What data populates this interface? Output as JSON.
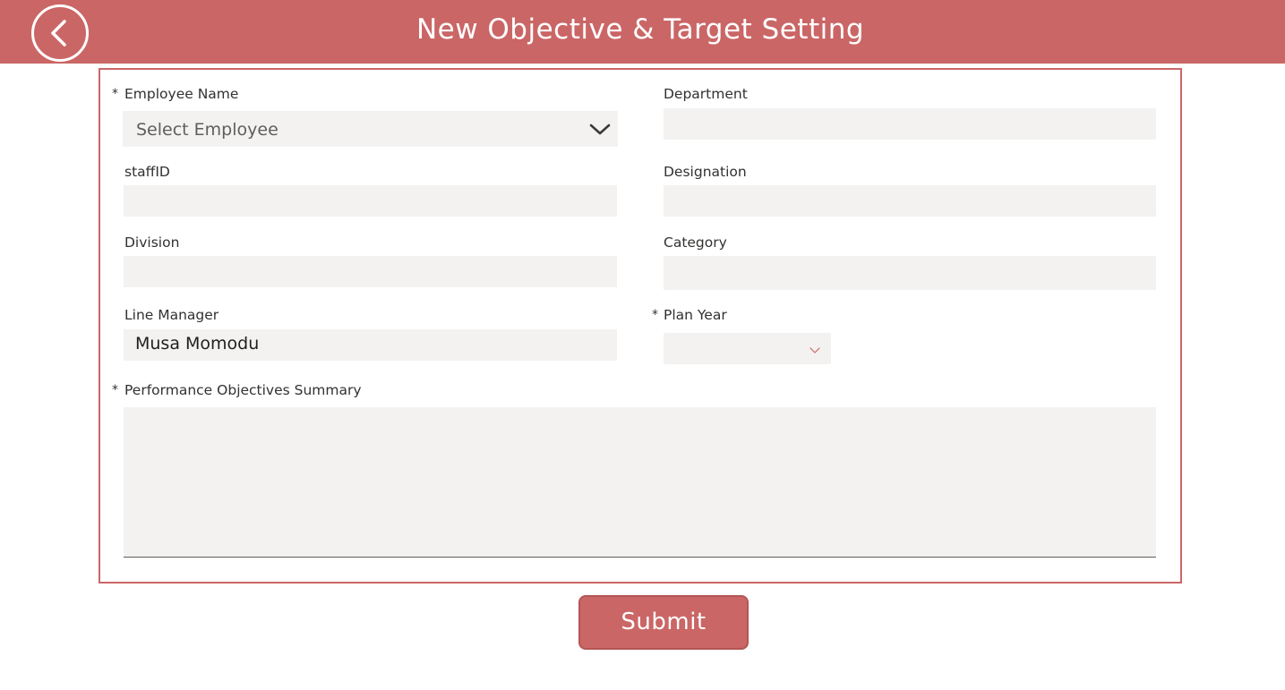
{
  "header": {
    "title": "New Objective & Target Setting",
    "back_icon": "chevron-left-circle-icon",
    "background_color": "#cb6666"
  },
  "form": {
    "required_marker": "*",
    "employee_name": {
      "label": "Employee Name",
      "required": true,
      "placeholder": "Select Employee",
      "icon": "chevron-down-icon"
    },
    "department": {
      "label": "Department",
      "value": ""
    },
    "staff_id": {
      "label": "staffID",
      "value": ""
    },
    "designation": {
      "label": "Designation",
      "value": ""
    },
    "division": {
      "label": "Division",
      "value": ""
    },
    "category": {
      "label": "Category",
      "value": ""
    },
    "line_manager": {
      "label": "Line Manager",
      "value": "Musa Momodu"
    },
    "plan_year": {
      "label": "Plan Year",
      "required": true,
      "value": "",
      "icon": "chevron-down-icon"
    },
    "objectives_summary": {
      "label": "Performance Objectives Summary",
      "required": true,
      "value": ""
    }
  },
  "actions": {
    "submit_label": "Submit"
  },
  "colors": {
    "accent": "#cb6666",
    "field_background": "#f3f2f1"
  }
}
